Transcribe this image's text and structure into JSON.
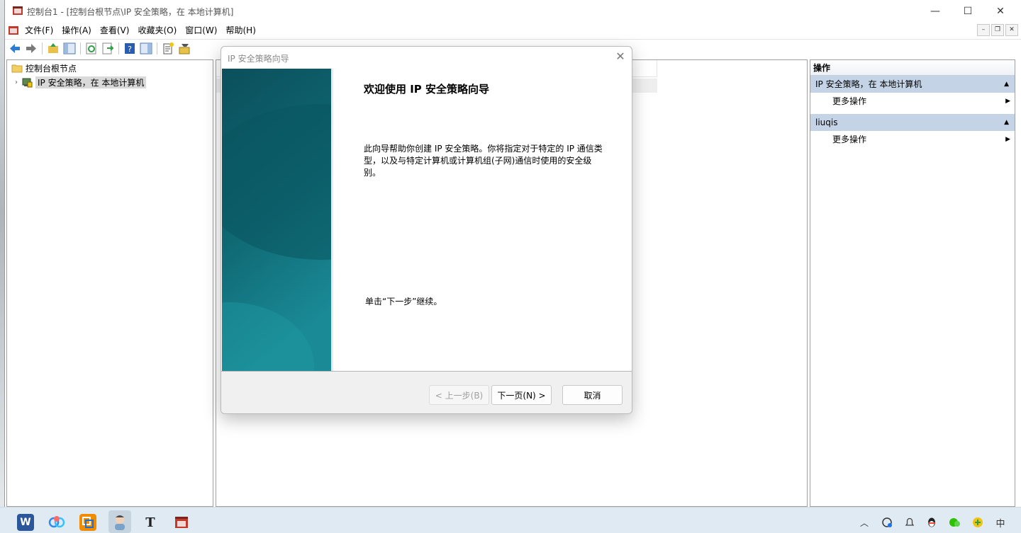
{
  "window": {
    "title": "控制台1 - [控制台根节点\\IP 安全策略，在 本地计算机]",
    "minimize": "—",
    "maximize": "☐",
    "close": "✕"
  },
  "menu": [
    "文件(F)",
    "操作(A)",
    "查看(V)",
    "收藏夹(O)",
    "窗口(W)",
    "帮助(H)"
  ],
  "mdi": {
    "min": "–",
    "restore": "❐",
    "close": "✕"
  },
  "tree": {
    "root": "控制台根节点",
    "child": "IP 安全策略，在 本地计算机",
    "expander": "›"
  },
  "actions": {
    "title": "操作",
    "sections": [
      {
        "label": "IP 安全策略，在 本地计算机",
        "item": "更多操作"
      },
      {
        "label": "liuqis",
        "item": "更多操作"
      }
    ]
  },
  "dialog": {
    "title": "IP 安全策略向导",
    "close": "✕",
    "heading": "欢迎使用 IP 安全策略向导",
    "description": "此向导帮助你创建 IP 安全策略。你将指定对于特定的 IP 通信类型，以及与特定计算机或计算机组(子网)通信时使用的安全级别。",
    "hint": "单击“下一步”继续。",
    "back_label": "< 上一步(B)",
    "next_label": "下一页(N) >",
    "cancel_label": "取消"
  },
  "taskbar": {
    "apps": [
      "word-app",
      "baidu-netdisk-app",
      "vmware-app",
      "user-avatar-app",
      "typora-app",
      "mmc-app"
    ],
    "typora_glyph": "T",
    "word_glyph": "W",
    "ime": "中"
  },
  "colors": {
    "selection": "#c4d3e6",
    "banner_top": "#0b4f5c",
    "banner_bottom": "#1c8a97"
  }
}
